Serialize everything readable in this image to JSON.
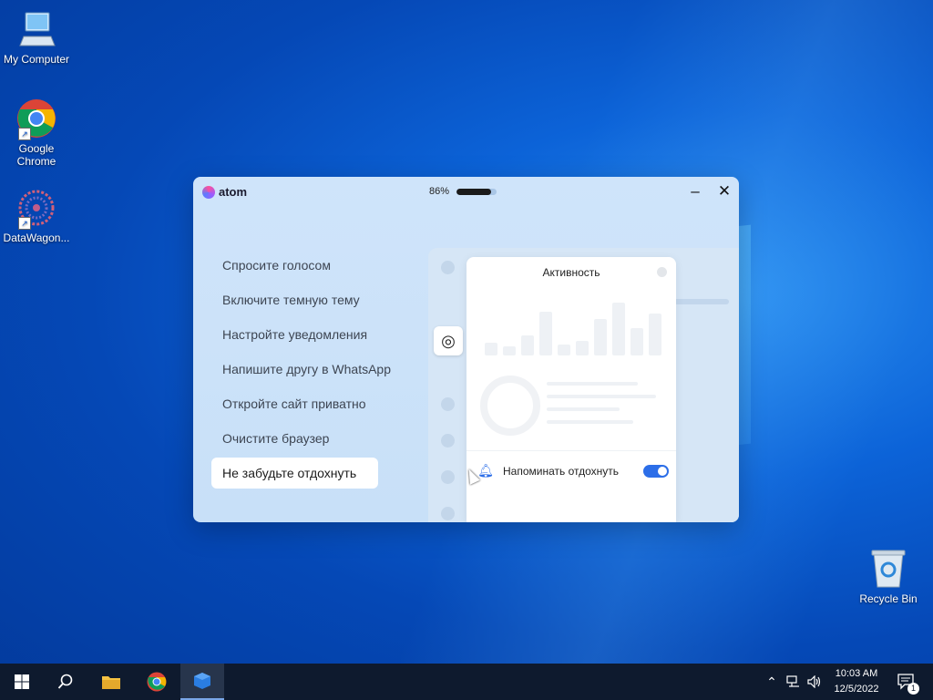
{
  "desktop": {
    "icons": [
      {
        "label": "My Computer",
        "icon": "computer-icon"
      },
      {
        "label": "Google Chrome",
        "icon": "chrome-icon"
      },
      {
        "label": "DataWagon...",
        "icon": "datawagon-icon"
      },
      {
        "label": "Recycle Bin",
        "icon": "recycle-bin-icon"
      }
    ]
  },
  "app": {
    "brand": "atom",
    "battery_text": "86%",
    "battery_level": 0.86,
    "menu": [
      "Спросите голосом",
      "Включите темную тему",
      "Настройте уведомления",
      "Напишите другу в WhatsApp",
      "Откройте сайт приватно",
      "Очистите браузер",
      "Не забудьте отдохнуть"
    ],
    "active_index": 6,
    "panel": {
      "title": "Активность",
      "remind_label": "Напоминать отдохнуть",
      "remind_on": true
    }
  },
  "taskbar": {
    "clock_time": "10:03 AM",
    "clock_date": "12/5/2022",
    "notification_count": "1"
  },
  "colors": {
    "accent": "#2c6ee8",
    "taskbar": "#0e1a2e",
    "window_bg": "#cfe4fa"
  }
}
